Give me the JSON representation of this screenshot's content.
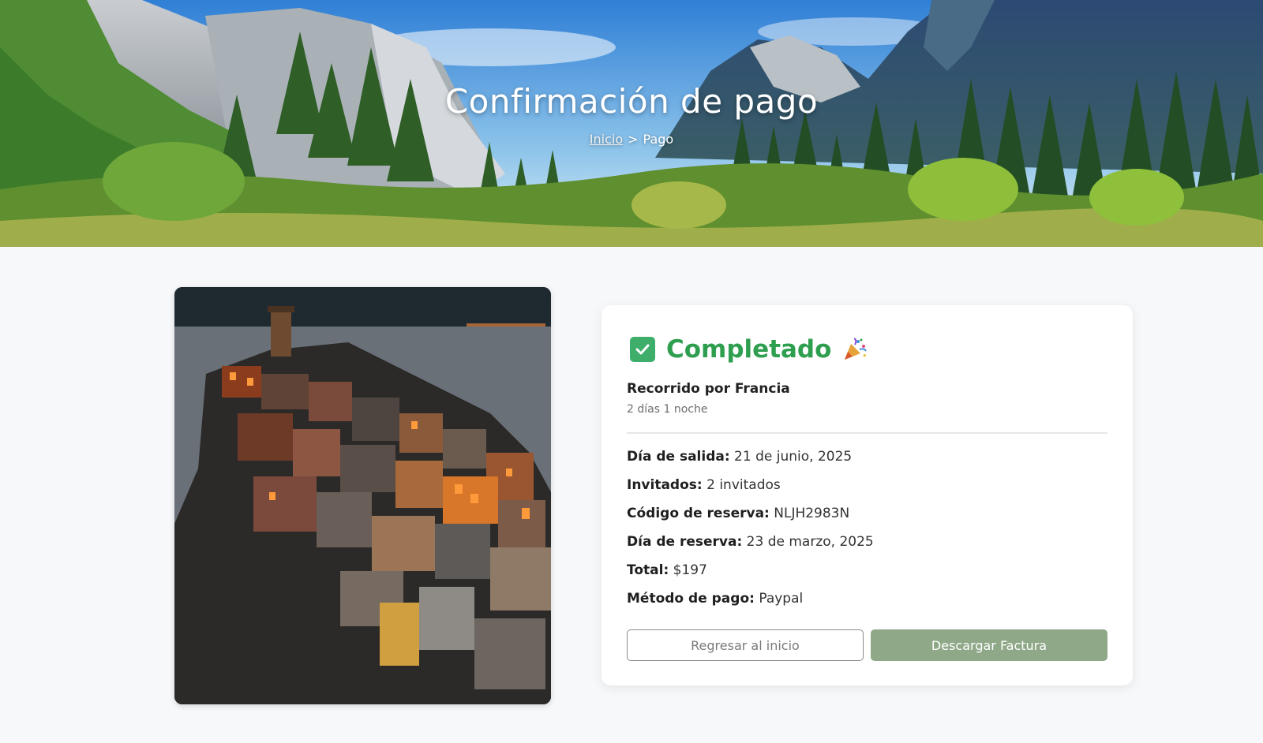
{
  "hero": {
    "title": "Confirmación de pago",
    "breadcrumb": {
      "home": "Inicio",
      "separator": ">",
      "current": "Pago"
    }
  },
  "confirmation": {
    "status": "Completado",
    "status_color": "#2e9e4f",
    "trip_name": "Recorrido por Francia",
    "trip_duration": "2 días 1 noche",
    "details": [
      {
        "label": "Día de salida:",
        "value": "21 de junio, 2025"
      },
      {
        "label": "Invitados:",
        "value": "2 invitados"
      },
      {
        "label": "Código de reserva:",
        "value": "NLJH2983N"
      },
      {
        "label": "Día de reserva:",
        "value": "23 de marzo, 2025"
      },
      {
        "label": "Total:",
        "value": "$197"
      },
      {
        "label": "Método de pago:",
        "value": "Paypal"
      }
    ],
    "buttons": {
      "home": "Regresar al inicio",
      "invoice": "Descargar Factura"
    }
  },
  "icons": {
    "status": "check-box-icon",
    "celebration": "party-popper-icon"
  },
  "colors": {
    "accent_green": "#3fae6a",
    "button_green": "#8fa988",
    "page_bg": "#f7f8fa"
  }
}
